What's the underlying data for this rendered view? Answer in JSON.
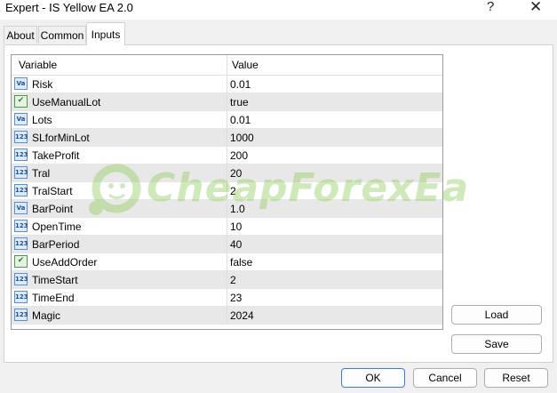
{
  "window": {
    "title": "Expert - IS Yellow EA 2.0",
    "help_glyph": "?",
    "close_glyph": "✕"
  },
  "tabs": [
    {
      "label": "About"
    },
    {
      "label": "Common"
    },
    {
      "label": "Inputs"
    }
  ],
  "active_tab": "Inputs",
  "grid": {
    "headers": {
      "variable": "Variable",
      "value": "Value"
    },
    "rows": [
      {
        "icon": "Va",
        "type": "double",
        "name": "Risk",
        "value": "0.01"
      },
      {
        "icon": "✔",
        "type": "bool",
        "name": "UseManualLot",
        "value": "true"
      },
      {
        "icon": "Va",
        "type": "double",
        "name": "Lots",
        "value": "0.01"
      },
      {
        "icon": "123",
        "type": "int",
        "name": "SLforMinLot",
        "value": "1000"
      },
      {
        "icon": "123",
        "type": "int",
        "name": "TakeProfit",
        "value": "200"
      },
      {
        "icon": "123",
        "type": "int",
        "name": "Tral",
        "value": "20"
      },
      {
        "icon": "123",
        "type": "int",
        "name": "TralStart",
        "value": "2"
      },
      {
        "icon": "Va",
        "type": "double",
        "name": "BarPoint",
        "value": "1.0"
      },
      {
        "icon": "123",
        "type": "int",
        "name": "OpenTime",
        "value": "10"
      },
      {
        "icon": "123",
        "type": "int",
        "name": "BarPeriod",
        "value": "40"
      },
      {
        "icon": "✔",
        "type": "bool",
        "name": "UseAddOrder",
        "value": "false"
      },
      {
        "icon": "123",
        "type": "int",
        "name": "TimeStart",
        "value": "2"
      },
      {
        "icon": "123",
        "type": "int",
        "name": "TimeEnd",
        "value": "23"
      },
      {
        "icon": "123",
        "type": "int",
        "name": "Magic",
        "value": "2024"
      }
    ]
  },
  "watermark": {
    "text": "CheapForexEa"
  },
  "side_buttons": {
    "load": "Load",
    "save": "Save"
  },
  "footer_buttons": {
    "ok": "OK",
    "cancel": "Cancel",
    "reset": "Reset"
  },
  "colors": {
    "watermark_green": "#8fcd5c",
    "ok_border": "#3a7bd5"
  }
}
